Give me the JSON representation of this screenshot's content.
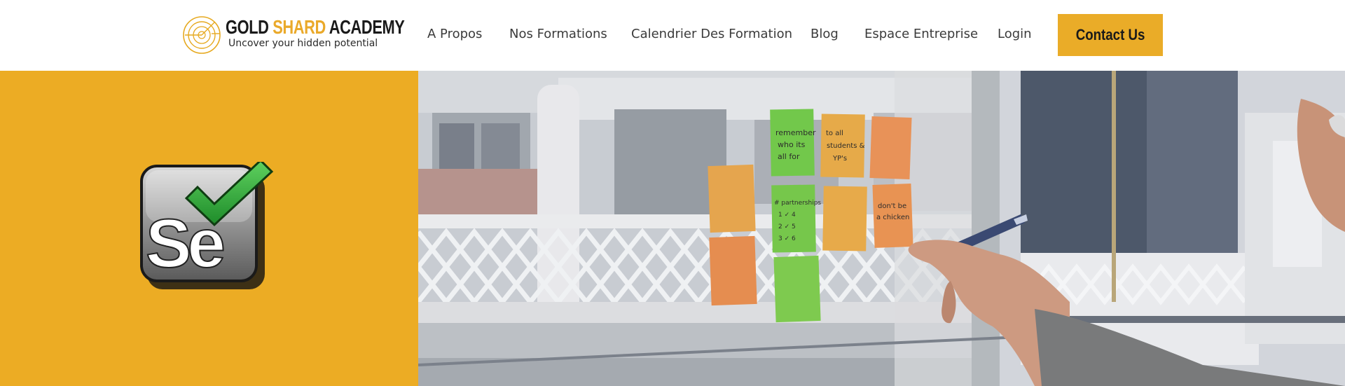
{
  "brand": {
    "title_part1": "GOLD ",
    "title_part2": "SHARD",
    "title_part3": " ACADEMY",
    "tagline": "Uncover  your hidden potential",
    "accent_color": "#eaac28"
  },
  "nav": {
    "items": [
      {
        "label": "A Propos"
      },
      {
        "label": "Nos Formations"
      },
      {
        "label": "Calendrier Des Formation"
      },
      {
        "label": "Blog"
      },
      {
        "label": "Espace Entreprise"
      },
      {
        "label": "Login"
      }
    ],
    "contact_label": "Contact Us"
  },
  "hero": {
    "left_panel_color": "#ecac24",
    "logo_text": "Se",
    "logo_icon": "selenium-logo-icon",
    "photo": {
      "notes": [
        {
          "text": "remember\nwho its\nall for"
        },
        {
          "text": "to all\nstudents &\nYP's"
        },
        {
          "text": "# partnerships\n1 ✓ 4\n2 ✓ 5\n3 ✓ 6"
        },
        {
          "text": "don't be\na chicken"
        }
      ]
    }
  }
}
